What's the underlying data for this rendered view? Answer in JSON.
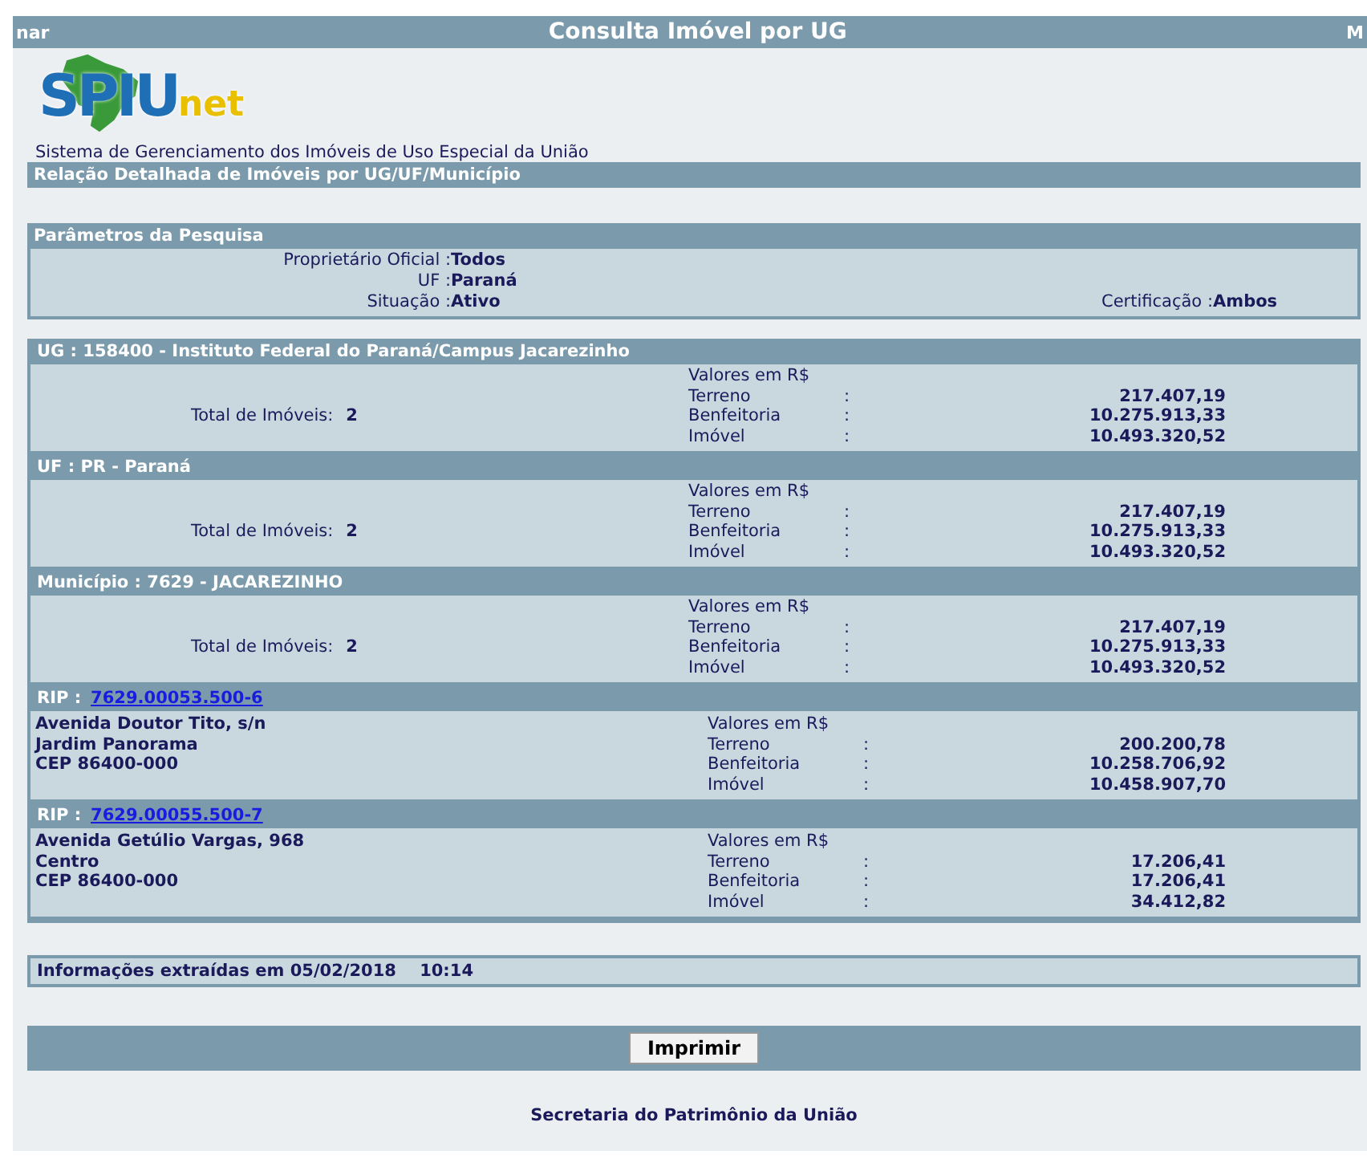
{
  "title_bar": {
    "left": "nar",
    "title": "Consulta Imóvel por UG",
    "right": "M"
  },
  "logo": {
    "main": "SPIU",
    "suffix": "net"
  },
  "subtitle": "Sistema de Gerenciamento dos Imóveis de Uso Especial da União",
  "report_heading": "Relação Detalhada de Imóveis por UG/UF/Município",
  "parameters": {
    "heading": "Parâmetros da Pesquisa",
    "fields": [
      {
        "label": "Proprietário Oficial :",
        "value": "Todos"
      },
      {
        "label": "UF :",
        "value": "Paraná"
      },
      {
        "label": "Situação :",
        "value": "Ativo"
      }
    ],
    "certification": {
      "label": "Certificação :",
      "value": "Ambos"
    }
  },
  "groups": [
    {
      "heading": "UG : 158400 - Instituto Federal do Paraná/Campus Jacarezinho",
      "total_label": "Total de Imóveis:",
      "total": "2",
      "values_heading": "Valores em R$",
      "values": [
        {
          "label": "Terreno",
          "sep": ":",
          "value": "217.407,19"
        },
        {
          "label": "Benfeitoria",
          "sep": ":",
          "value": "10.275.913,33"
        },
        {
          "label": "Imóvel",
          "sep": ":",
          "value": "10.493.320,52"
        }
      ]
    },
    {
      "heading": "UF : PR - Paraná",
      "total_label": "Total de Imóveis:",
      "total": "2",
      "values_heading": "Valores em R$",
      "values": [
        {
          "label": "Terreno",
          "sep": ":",
          "value": "217.407,19"
        },
        {
          "label": "Benfeitoria",
          "sep": ":",
          "value": "10.275.913,33"
        },
        {
          "label": "Imóvel",
          "sep": ":",
          "value": "10.493.320,52"
        }
      ]
    },
    {
      "heading": "Município : 7629 - JACAREZINHO",
      "total_label": "Total de Imóveis:",
      "total": "2",
      "values_heading": "Valores em R$",
      "values": [
        {
          "label": "Terreno",
          "sep": ":",
          "value": "217.407,19"
        },
        {
          "label": "Benfeitoria",
          "sep": ":",
          "value": "10.275.913,33"
        },
        {
          "label": "Imóvel",
          "sep": ":",
          "value": "10.493.320,52"
        }
      ]
    }
  ],
  "properties": [
    {
      "rip_label": "RIP :",
      "rip": "7629.00053.500-6",
      "address": [
        "Avenida  Doutor Tito, s/n",
        "Jardim Panorama",
        "CEP 86400-000"
      ],
      "values_heading": "Valores em R$",
      "values": [
        {
          "label": "Terreno",
          "sep": ":",
          "value": "200.200,78"
        },
        {
          "label": "Benfeitoria",
          "sep": ":",
          "value": "10.258.706,92"
        },
        {
          "label": "Imóvel",
          "sep": ":",
          "value": "10.458.907,70"
        }
      ]
    },
    {
      "rip_label": "RIP :",
      "rip": "7629.00055.500-7",
      "address": [
        "Avenida  Getúlio Vargas, 968",
        "Centro",
        "CEP 86400-000"
      ],
      "values_heading": "Valores em R$",
      "values": [
        {
          "label": "Terreno",
          "sep": ":",
          "value": "17.206,41"
        },
        {
          "label": "Benfeitoria",
          "sep": ":",
          "value": "17.206,41"
        },
        {
          "label": "Imóvel",
          "sep": ":",
          "value": "34.412,82"
        }
      ]
    }
  ],
  "extracted": "Informações extraídas em 05/02/2018    10:14",
  "print_button": "Imprimir",
  "footer": "Secretaria do Patrimônio da União"
}
